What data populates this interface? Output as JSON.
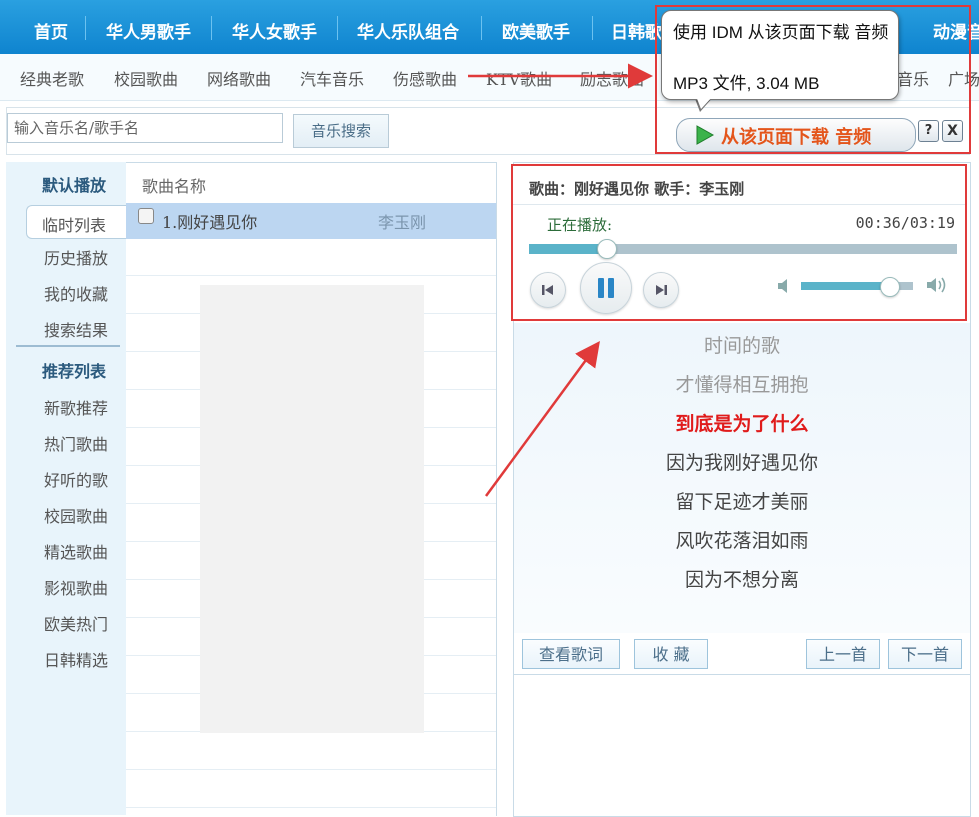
{
  "nav": {
    "items": [
      "首页",
      "华人男歌手",
      "华人女歌手",
      "华人乐队组合",
      "欧美歌手",
      "日韩歌手",
      "动漫音乐"
    ]
  },
  "subnav": {
    "items": [
      "经典老歌",
      "校园歌曲",
      "网络歌曲",
      "汽车音乐",
      "伤感歌曲",
      "KTV歌曲",
      "励志歌曲",
      "音乐",
      "广场舞"
    ]
  },
  "search": {
    "placeholder": "输入音乐名/歌手名",
    "button": "音乐搜索"
  },
  "sidebar": {
    "default_title": "默认播放",
    "default_items": [
      "临时列表",
      "历史播放",
      "我的收藏",
      "搜索结果"
    ],
    "recommend_title": "推荐列表",
    "recommend_items": [
      "新歌推荐",
      "热门歌曲",
      "好听的歌",
      "校园歌曲",
      "精选歌曲",
      "影视歌曲",
      "欧美热门",
      "日韩精选"
    ]
  },
  "songlist": {
    "header": "歌曲名称",
    "songs": [
      {
        "name": "1.刚好遇见你",
        "singer": "李玉刚"
      }
    ]
  },
  "player": {
    "song_info": "歌曲：刚好遇见你 歌手：李玉刚",
    "status": "正在播放:",
    "time": "00:36/03:19",
    "progress": 0.18,
    "volume": 0.79
  },
  "lyrics": {
    "lines": [
      "时间的歌",
      "才懂得相互拥抱",
      "到底是为了什么",
      "因为我刚好遇见你",
      "留下足迹才美丽",
      "风吹花落泪如雨",
      "因为不想分离"
    ],
    "current_index": 2
  },
  "panel_buttons": {
    "view_lyrics": "查看歌词",
    "favorite": "收 藏",
    "prev": "上一首",
    "next": "下一首"
  },
  "idm": {
    "tooltip_line1": "使用 IDM 从该页面下载 音频",
    "tooltip_line2": "MP3 文件, 3.04 MB",
    "download_label": "从该页面下载 音频",
    "help": "?",
    "close": "X"
  },
  "colors": {
    "nav_blue": "#1a91d8",
    "annotation_red": "#e03a3a",
    "lyric_current": "#e01b1b",
    "idm_orange": "#e4551b"
  }
}
